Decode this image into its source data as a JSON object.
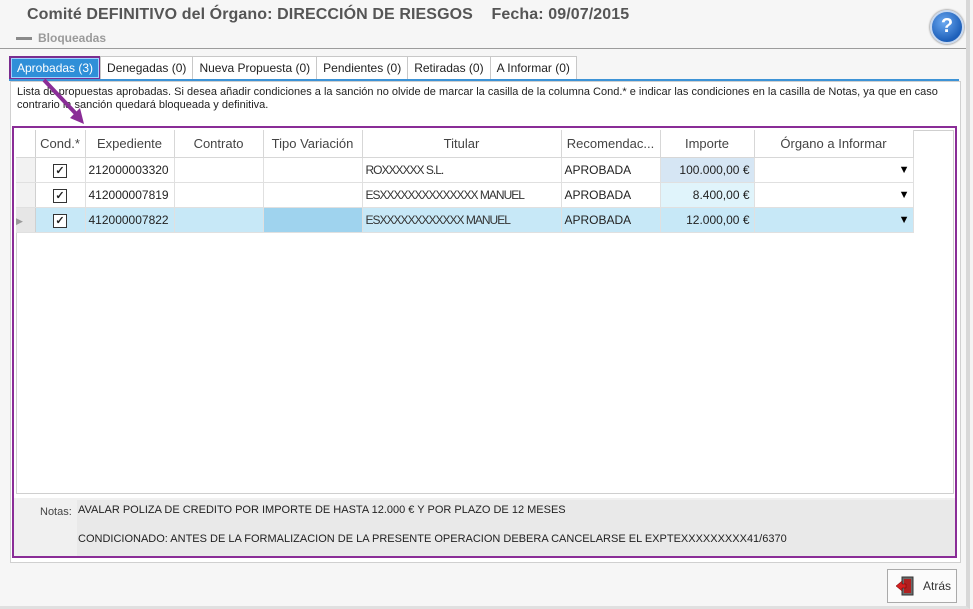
{
  "header": {
    "title": "Comité DEFINITIVO del Órgano: DIRECCIÓN DE RIESGOS",
    "date": "Fecha: 09/07/2015",
    "subtitle": "Bloqueadas",
    "help_icon": "question-mark-icon"
  },
  "tabs": [
    {
      "label": "Aprobadas (3)",
      "active": true
    },
    {
      "label": "Denegadas (0)"
    },
    {
      "label": "Nueva Propuesta (0)"
    },
    {
      "label": "Pendientes (0)"
    },
    {
      "label": "Retiradas (0)"
    },
    {
      "label": "A Informar (0)"
    }
  ],
  "info_text": "Lista de propuestas aprobadas. Si desea añadir condiciones a la sanción no olvide de marcar la casilla de la columna Cond.* e indicar las condiciones en la casilla de Notas, ya que en caso contrario la sanción quedará bloqueada y definitiva.",
  "grid": {
    "columns": [
      "Cond.*",
      "Expediente",
      "Contrato",
      "Tipo Variación",
      "Titular",
      "Recomendac...",
      "Importe",
      "Órgano a Informar"
    ],
    "rows": [
      {
        "cond": true,
        "expediente": "212000003320",
        "contrato": "",
        "tipo": "",
        "titular": "ROXXXXXX S.L.",
        "recomendacion": "APROBADA",
        "importe": "100.000,00 €",
        "organo": ""
      },
      {
        "cond": true,
        "expediente": "412000007819",
        "contrato": "",
        "tipo": "",
        "titular": "ESXXXXXXXXXXXXXX MANUEL",
        "recomendacion": "APROBADA",
        "importe": "8.400,00 €",
        "organo": ""
      },
      {
        "cond": true,
        "expediente": "412000007822",
        "contrato": "",
        "tipo": "",
        "titular": "ESXXXXXXXXXXXX MANUEL",
        "recomendacion": "APROBADA",
        "importe": "12.000,00 €",
        "organo": "",
        "selected": true
      }
    ]
  },
  "notes": {
    "label": "Notas:",
    "line1": "AVALAR POLIZA DE CREDITO POR IMPORTE DE HASTA 12.000 €  Y POR PLAZO DE 12 MESES",
    "line2": "CONDICIONADO: ANTES DE LA FORMALIZACION DE LA PRESENTE OPERACION DEBERA CANCELARSE EL EXPTEXXXXXXXXX41/6370"
  },
  "back_button": {
    "label": "Atrás",
    "icon": "exit-door-icon"
  },
  "colors": {
    "tab_active": "#2f8fd8",
    "annotation": "#8a2d97",
    "selected_row": "#c7e8f7"
  }
}
